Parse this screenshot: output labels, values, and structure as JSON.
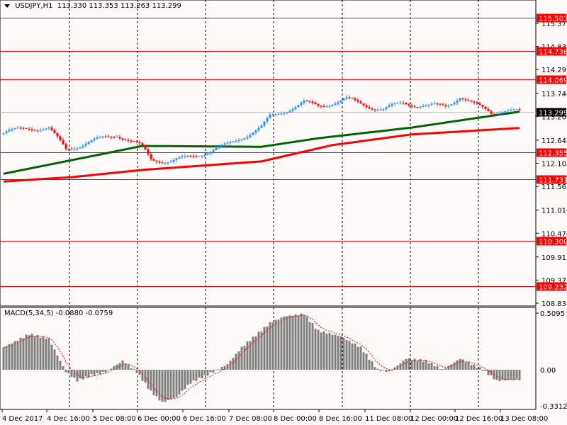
{
  "header": {
    "symbol": "USDJPY,H1",
    "open": "113.330",
    "high": "113.353",
    "low": "113.263",
    "close": "113.299"
  },
  "macd": {
    "label": "MACD(5,34,5)",
    "main": "-0.0880",
    "signal": "-0.0759",
    "ticks": [
      "0.5095",
      "0.00",
      "-0.3312"
    ]
  },
  "chart_data": {
    "type": "candlestick",
    "price_ticks": [
      "115.375",
      "114.835",
      "114.295",
      "113.740",
      "113.200",
      "112.645",
      "112.105",
      "111.565",
      "111.010",
      "110.470",
      "109.915",
      "109.375",
      "108.835"
    ],
    "price_range": [
      108.835,
      115.375
    ],
    "current_price": "113.299",
    "levels": [
      "115.503",
      "114.736",
      "114.069",
      "112.355",
      "111.731",
      "110.300",
      "109.232"
    ],
    "time_labels": [
      "4 Dec 2017",
      "4 Dec 16:00",
      "5 Dec 08:00",
      "6 Dec 00:00",
      "6 Dec 16:00",
      "7 Dec 08:00",
      "8 Dec 00:00",
      "8 Dec 16:00",
      "11 Dec 08:00",
      "12 Dec 00:00",
      "12 Dec 16:00",
      "13 Dec 08:00"
    ],
    "bars": 183,
    "close_anchors": [
      [
        0,
        112.81
      ],
      [
        9,
        112.94
      ],
      [
        16,
        112.91
      ],
      [
        22,
        112.44
      ],
      [
        31,
        112.61
      ],
      [
        40,
        112.78
      ],
      [
        49,
        112.48
      ],
      [
        52,
        112.2
      ],
      [
        59,
        112.15
      ],
      [
        66,
        112.25
      ],
      [
        74,
        112.42
      ],
      [
        79,
        112.53
      ],
      [
        85,
        112.75
      ],
      [
        91,
        112.94
      ],
      [
        94,
        113.19
      ],
      [
        99,
        113.33
      ],
      [
        106,
        113.52
      ],
      [
        111,
        113.44
      ],
      [
        121,
        113.6
      ],
      [
        129,
        113.44
      ],
      [
        134,
        113.36
      ],
      [
        141,
        113.52
      ],
      [
        149,
        113.44
      ],
      [
        156,
        113.44
      ],
      [
        161,
        113.67
      ],
      [
        166,
        113.47
      ],
      [
        172,
        113.3
      ],
      [
        177,
        113.35
      ],
      [
        182,
        113.3
      ]
    ],
    "ma_slow": [
      [
        0,
        111.86
      ],
      [
        49,
        112.51
      ],
      [
        91,
        112.49
      ],
      [
        111,
        112.69
      ],
      [
        144,
        112.94
      ],
      [
        182,
        113.31
      ]
    ],
    "ma_slower": [
      [
        0,
        111.68
      ],
      [
        24,
        111.78
      ],
      [
        49,
        111.95
      ],
      [
        91,
        112.15
      ],
      [
        116,
        112.53
      ],
      [
        144,
        112.78
      ],
      [
        182,
        112.93
      ]
    ],
    "macd_range": [
      -0.3312,
      0.5095
    ],
    "macd_anchors": [
      [
        0,
        0.2
      ],
      [
        9,
        0.32
      ],
      [
        16,
        0.28
      ],
      [
        22,
        -0.02
      ],
      [
        26,
        -0.1
      ],
      [
        31,
        -0.05
      ],
      [
        36,
        -0.02
      ],
      [
        42,
        0.08
      ],
      [
        47,
        -0.02
      ],
      [
        52,
        -0.2
      ],
      [
        56,
        -0.3
      ],
      [
        61,
        -0.25
      ],
      [
        66,
        -0.12
      ],
      [
        74,
        -0.02
      ],
      [
        79,
        0.05
      ],
      [
        84,
        0.2
      ],
      [
        94,
        0.42
      ],
      [
        99,
        0.48
      ],
      [
        106,
        0.5
      ],
      [
        111,
        0.35
      ],
      [
        119,
        0.3
      ],
      [
        126,
        0.2
      ],
      [
        132,
        0.0
      ],
      [
        136,
        -0.02
      ],
      [
        142,
        0.1
      ],
      [
        149,
        0.08
      ],
      [
        155,
        0.0
      ],
      [
        161,
        0.1
      ],
      [
        169,
        0.0
      ],
      [
        174,
        -0.1
      ],
      [
        182,
        -0.088
      ]
    ],
    "colors": {
      "up": "#1e90ff",
      "down": "#ff0000",
      "ma_slow": "#006400",
      "ma_slower": "#ff0000",
      "level": "#ff0000",
      "hist": "#808080"
    }
  }
}
